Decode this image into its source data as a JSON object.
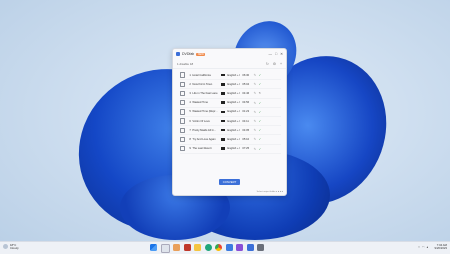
{
  "window": {
    "app_name": "DVDfab",
    "badge": "NEW",
    "controls": [
      "—",
      "□",
      "✕"
    ]
  },
  "toolbar": {
    "selected_text": "1 disable 18",
    "icons": [
      "refresh-icon",
      "settings-icon",
      "add-icon"
    ]
  },
  "tracks": [
    {
      "index": "1",
      "title": "Hotel California",
      "lang": "English + Inst...",
      "duration": "06:30",
      "status": "✓"
    },
    {
      "index": "2",
      "title": "New Kid in Town",
      "lang": "English + Inst...",
      "duration": "05:04",
      "status": "✓"
    },
    {
      "index": "3",
      "title": "Life in The Fast Lane",
      "lang": "English + Inst...",
      "duration": "04:46",
      "status": "↻"
    },
    {
      "index": "4",
      "title": "Wasted Time",
      "lang": "English + Inst...",
      "duration": "04:56",
      "status": "✓"
    },
    {
      "index": "5",
      "title": "Wasted Time (Repr...",
      "lang": "English + Inst...",
      "duration": "01:23",
      "status": "✓"
    },
    {
      "index": "6",
      "title": "Victim Of Love",
      "lang": "English + Inst...",
      "duration": "04:11",
      "status": "✓"
    },
    {
      "index": "7",
      "title": "Pretty Maids All In...",
      "lang": "English + Inst...",
      "duration": "04:05",
      "status": "✓"
    },
    {
      "index": "8",
      "title": "Try And Love Again",
      "lang": "English + Inst...",
      "duration": "05:10",
      "status": "✓"
    },
    {
      "index": "9",
      "title": "The Last Resort",
      "lang": "English + Inst...",
      "duration": "07:25",
      "status": "✓"
    }
  ],
  "convert_label": "CONVERT",
  "footer": "Select output folder  ▸  ●  ●  ●",
  "taskbar": {
    "weather_temp": "18°C",
    "weather_desc": "Cloudy",
    "time": "7:04 AM",
    "date": "9/26/2023"
  }
}
